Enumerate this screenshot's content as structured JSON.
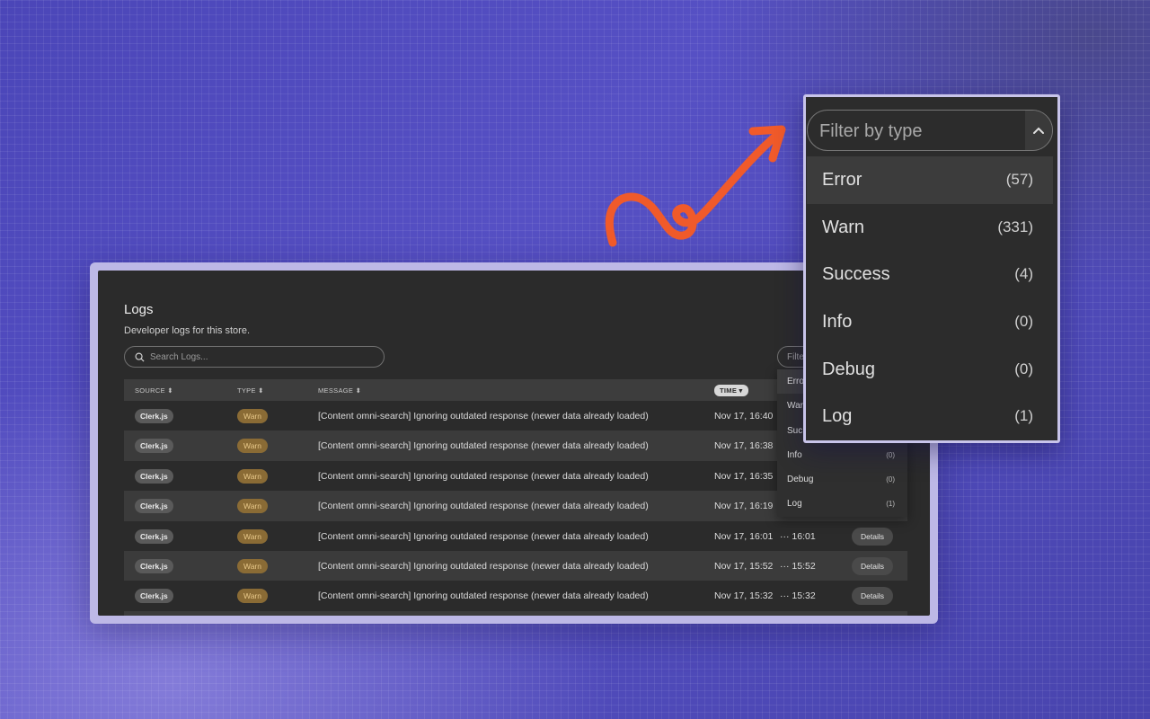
{
  "logs": {
    "title": "Logs",
    "subtitle": "Developer logs for this store.",
    "search_placeholder": "Search Logs...",
    "filter_placeholder": "Filter by type",
    "filter_visible_text": "Filte",
    "columns": {
      "source": "SOURCE ⬍",
      "type": "TYPE ⬍",
      "message": "MESSAGE ⬍",
      "time": "TIME ▾"
    },
    "rows": [
      {
        "source": "Clerk.js",
        "type": "Warn",
        "message": "[Content omni-search] Ignoring outdated response (newer data already loaded)",
        "time": "Nov 17, 16:40"
      },
      {
        "source": "Clerk.js",
        "type": "Warn",
        "message": "[Content omni-search] Ignoring outdated response (newer data already loaded)",
        "time": "Nov 17, 16:38"
      },
      {
        "source": "Clerk.js",
        "type": "Warn",
        "message": "[Content omni-search] Ignoring outdated response (newer data already loaded)",
        "time": "Nov 17, 16:35"
      },
      {
        "source": "Clerk.js",
        "type": "Warn",
        "message": "[Content omni-search] Ignoring outdated response (newer data already loaded)",
        "time": "Nov 17, 16:19"
      },
      {
        "source": "Clerk.js",
        "type": "Warn",
        "message": "[Content omni-search] Ignoring outdated response (newer data already loaded)",
        "time": "Nov 17, 16:01",
        "time2": "··· 16:01",
        "details": "Details"
      },
      {
        "source": "Clerk.js",
        "type": "Warn",
        "message": "[Content omni-search] Ignoring outdated response (newer data already loaded)",
        "time": "Nov 17, 15:52",
        "time2": "··· 15:52",
        "details": "Details"
      },
      {
        "source": "Clerk.js",
        "type": "Warn",
        "message": "[Content omni-search] Ignoring outdated response (newer data already loaded)",
        "time": "Nov 17, 15:32",
        "time2": "··· 15:32",
        "details": "Details"
      }
    ],
    "mini_dropdown": [
      {
        "label": "Erro",
        "count": ""
      },
      {
        "label": "War",
        "count": ""
      },
      {
        "label": "Suc",
        "count": ""
      },
      {
        "label": "Info",
        "count": "(0)"
      },
      {
        "label": "Debug",
        "count": "(0)"
      },
      {
        "label": "Log",
        "count": "(1)"
      }
    ]
  },
  "zoom_filter": {
    "placeholder": "Filter by type",
    "chevron_icon": "chevron-up-icon",
    "options": [
      {
        "label": "Error",
        "count": "(57)"
      },
      {
        "label": "Warn",
        "count": "(331)"
      },
      {
        "label": "Success",
        "count": "(4)"
      },
      {
        "label": "Info",
        "count": "(0)"
      },
      {
        "label": "Debug",
        "count": "(0)"
      },
      {
        "label": "Log",
        "count": "(1)"
      }
    ]
  },
  "colors": {
    "accent_arrow": "#f05a2a",
    "warn_badge": "#8a6b35",
    "panel_bg": "#2b2b2b"
  }
}
